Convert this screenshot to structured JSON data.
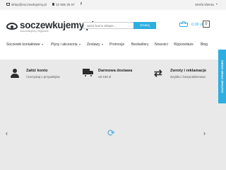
{
  "topbar": {
    "email": "sklep@soczewkujemy.pl",
    "phone": "22 855 25 67",
    "facebook_glyph": "f",
    "account_label": "Strefa klienta"
  },
  "header": {
    "logo_text": "soczewkujemy.pl",
    "logo_tagline": "Soczewkujemy Wygodnie",
    "search_placeholder": "wpisz kod w sklepie...",
    "search_button": "Szukaj",
    "cart_price": "0,00 zł",
    "cart_count": "0"
  },
  "nav": {
    "items": [
      {
        "label": "Soczewki kontaktowe",
        "has_dropdown": true
      },
      {
        "label": "Płyny i akcesoria",
        "has_dropdown": true
      },
      {
        "label": "Zestawy",
        "has_dropdown": true
      },
      {
        "label": "Promocje",
        "has_dropdown": false
      },
      {
        "label": "Bestsellery",
        "has_dropdown": false
      },
      {
        "label": "Nowości",
        "has_dropdown": false
      },
      {
        "label": "Wyprzedaże",
        "has_dropdown": false
      },
      {
        "label": "Blog",
        "has_dropdown": false
      }
    ]
  },
  "features": [
    {
      "title": "Załóż konto",
      "subtitle": "i korzystaj z przywilejów",
      "icon": "user-icon"
    },
    {
      "title": "Darmowa dostawa",
      "subtitle": "od 449 zł",
      "icon": "truck-icon"
    },
    {
      "title": "Zwroty i reklamacje",
      "subtitle": "Szybko i bezproblemowo",
      "icon": "refresh-icon"
    }
  ],
  "slider": {
    "prev_glyph": "‹",
    "next_glyph": "›",
    "loading_glyph": "⟳"
  },
  "side_tab": {
    "label": "ZAUFANE OPINIE CENEO"
  },
  "colors": {
    "accent": "#2eaee0",
    "band": "#e9e9e9",
    "topbar": "#f3f3f3"
  }
}
